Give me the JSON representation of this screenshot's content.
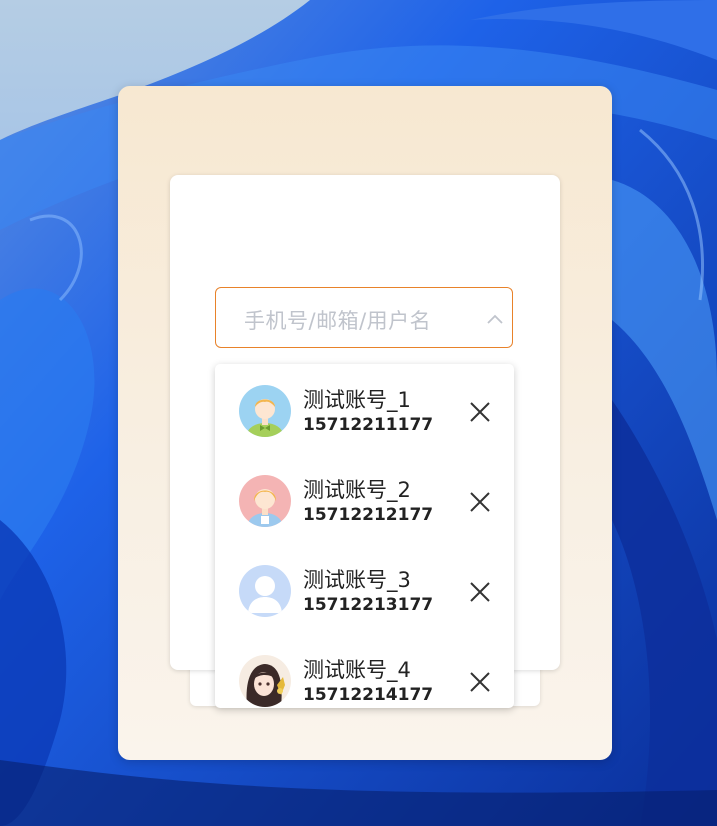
{
  "login": {
    "account_placeholder": "手机号/邮箱/用户名"
  },
  "accounts": [
    {
      "name": "测试账号_1",
      "phone": "15712211177"
    },
    {
      "name": "测试账号_2",
      "phone": "15712212177"
    },
    {
      "name": "测试账号_3",
      "phone": "15712213177"
    },
    {
      "name": "测试账号_4",
      "phone": "15712214177"
    }
  ],
  "colors": {
    "accent": "#e8822a",
    "panel_bg": "#f7e8d1",
    "placeholder": "#c0c4cc",
    "wallpaper": "#1a5fe6"
  },
  "icons": {
    "chevron": "chevron-up-icon",
    "remove": "close-icon"
  }
}
